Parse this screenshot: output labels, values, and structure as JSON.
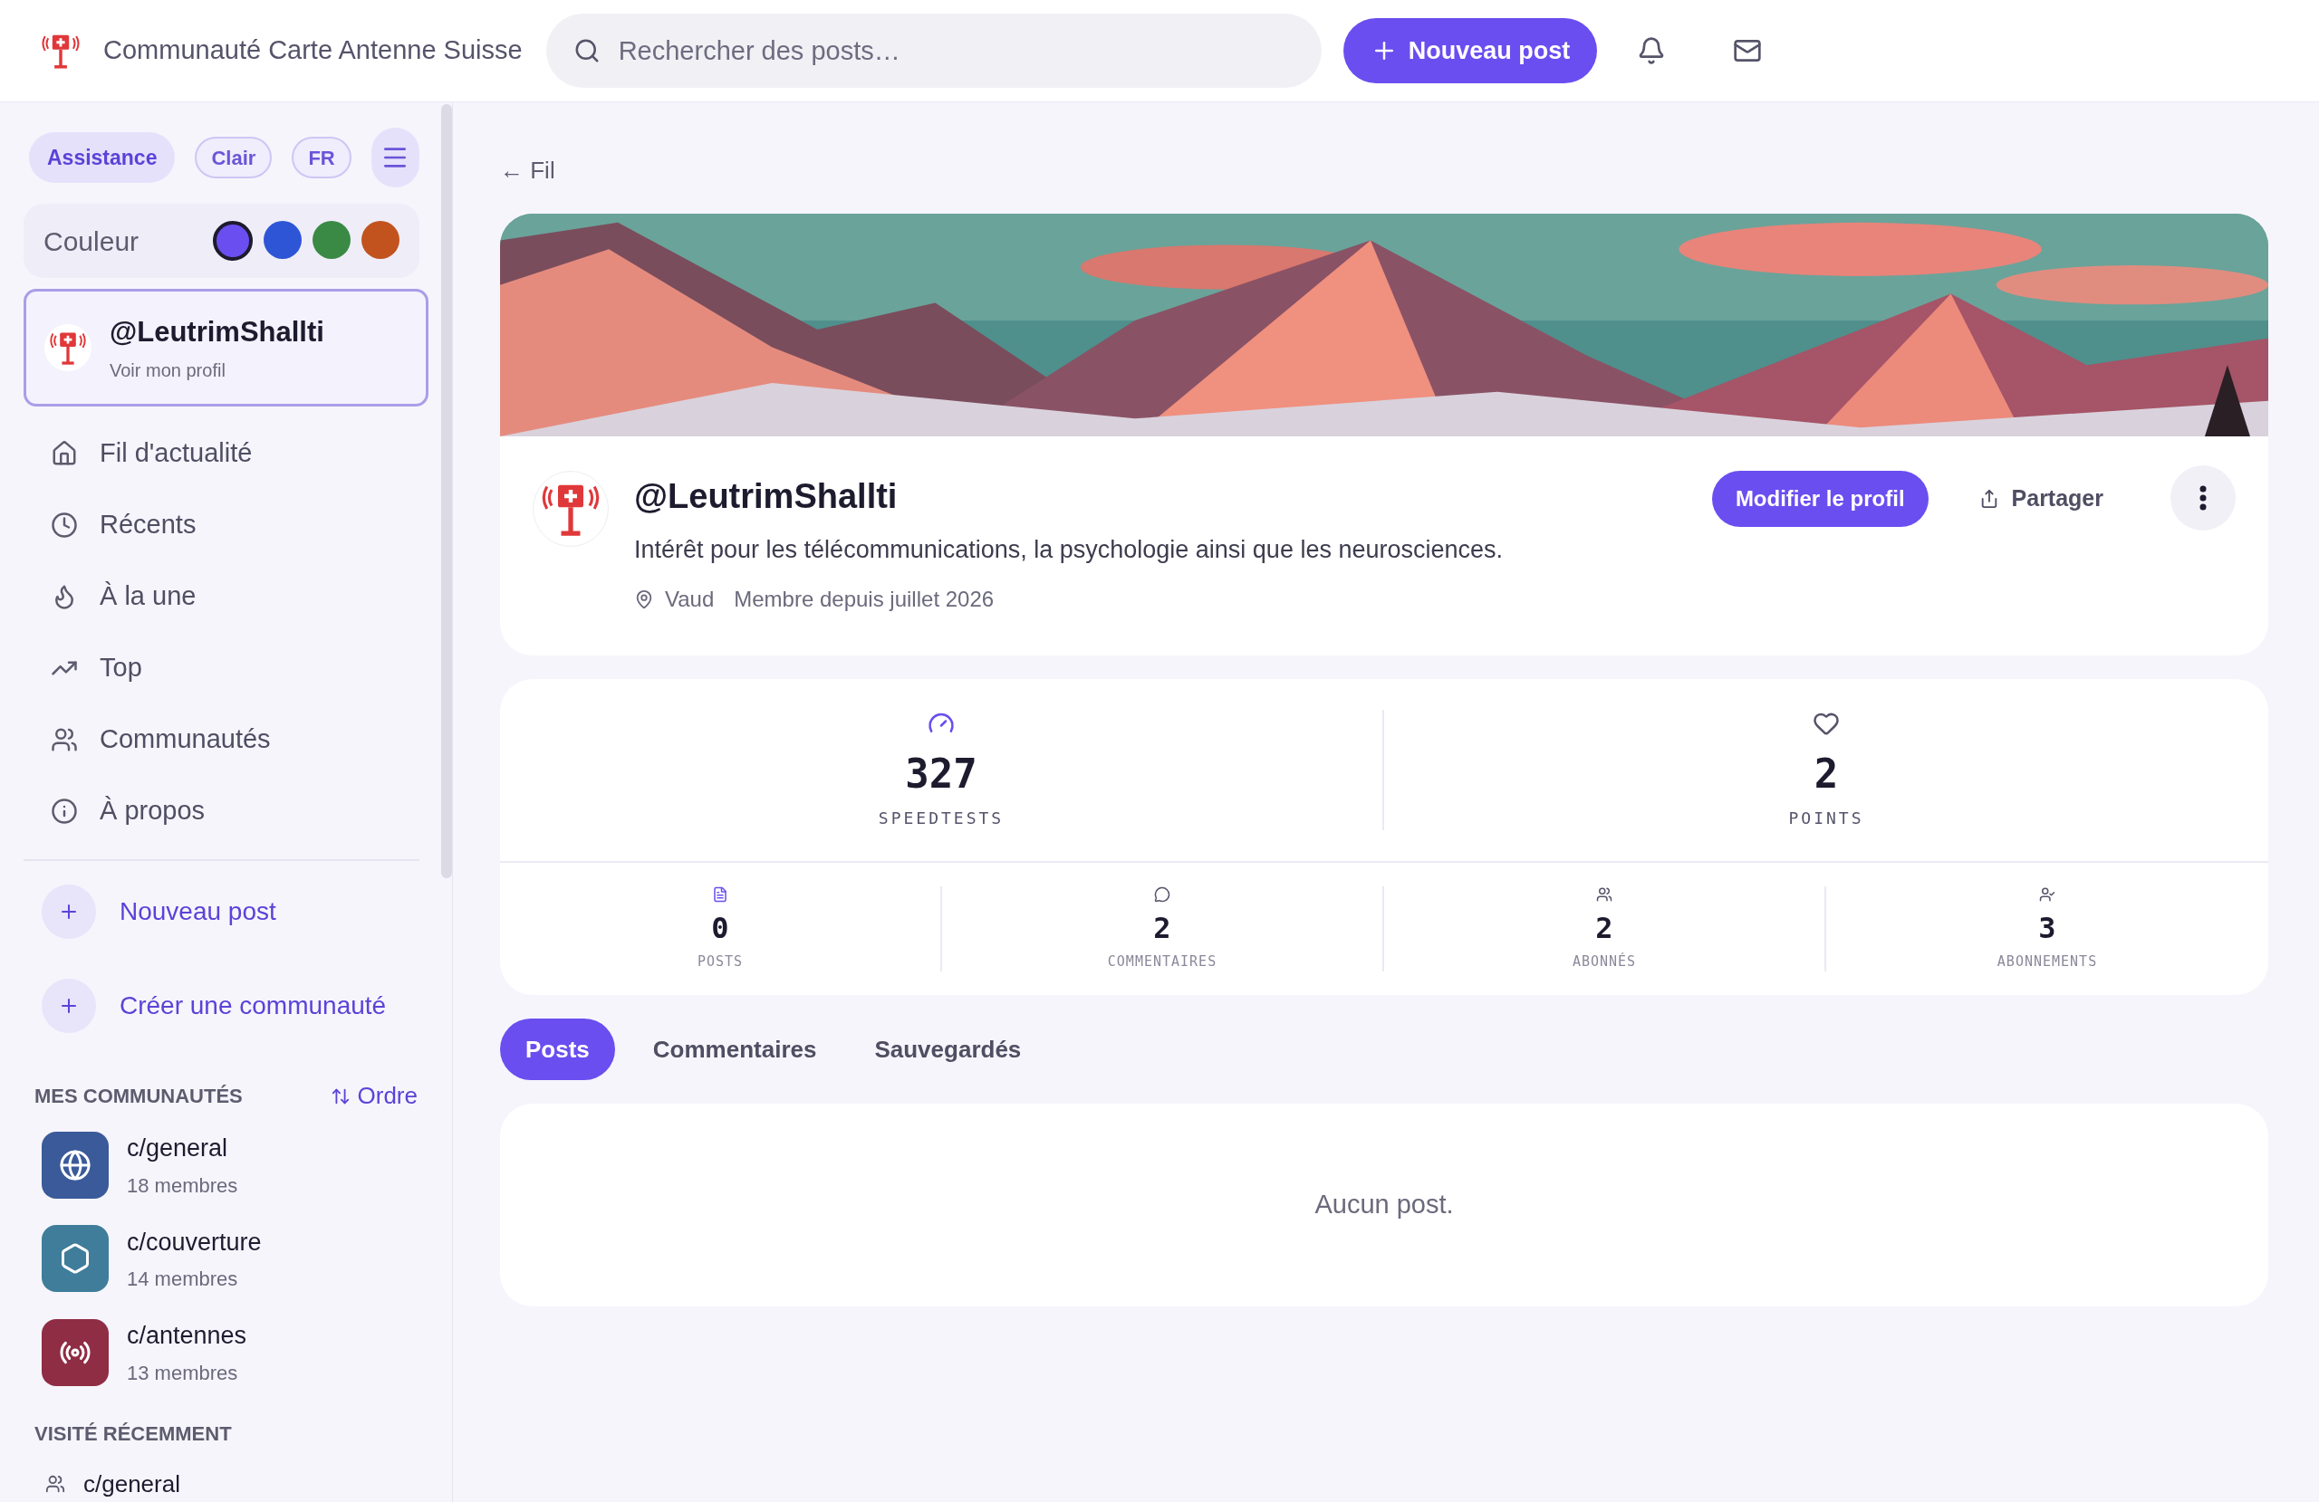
{
  "header": {
    "title": "Communauté Carte Antenne Suisse",
    "search": {
      "placeholder": "Rechercher des posts…"
    },
    "new_post": "Nouveau post"
  },
  "sidebar": {
    "chips": [
      {
        "label": "Assistance",
        "kind": "filled"
      },
      {
        "label": "Clair",
        "kind": "outline"
      },
      {
        "label": "FR",
        "kind": "outline"
      }
    ],
    "color_label": "Couleur",
    "colors": [
      {
        "color": "#6b4ef0",
        "selected": true
      },
      {
        "color": "#2d55d6",
        "selected": false
      },
      {
        "color": "#3a8a45",
        "selected": false
      },
      {
        "color": "#c2531f",
        "selected": false
      }
    ],
    "profile": {
      "name": "@LeutrimShallti",
      "link": "Voir mon profil"
    },
    "nav": [
      {
        "label": "Fil d'actualité"
      },
      {
        "label": "Récents"
      },
      {
        "label": "À la une"
      },
      {
        "label": "Top"
      },
      {
        "label": "Communautés"
      },
      {
        "label": "À propos"
      }
    ],
    "actions": [
      "Nouveau post",
      "Créer une communauté"
    ],
    "my_communities": {
      "title": "MES COMMUNAUTÉS",
      "sort": "Ordre",
      "items": [
        {
          "name": "c/general",
          "members": "18 membres",
          "color": "#3a5a9a"
        },
        {
          "name": "c/couverture",
          "members": "14 membres",
          "color": "#3f7d9a"
        },
        {
          "name": "c/antennes",
          "members": "13 membres",
          "color": "#8f2d45"
        }
      ]
    },
    "recent": {
      "title": "VISITÉ RÉCEMMENT",
      "items": [
        "c/general"
      ]
    }
  },
  "main": {
    "back": "← Fil",
    "profile": {
      "name": "@LeutrimShallti",
      "bio": "Intérêt pour les télécommunications, la psychologie ainsi que les neurosciences.",
      "location": "Vaud",
      "since": "Membre depuis juillet 2026",
      "edit": "Modifier le profil",
      "share": "Partager"
    },
    "big_stats": [
      {
        "value": "327",
        "label": "SPEEDTESTS"
      },
      {
        "value": "2",
        "label": "POINTS"
      }
    ],
    "small_stats": [
      {
        "value": "0",
        "label": "POSTS"
      },
      {
        "value": "2",
        "label": "COMMENTAIRES"
      },
      {
        "value": "2",
        "label": "ABONNÉS"
      },
      {
        "value": "3",
        "label": "ABONNEMENTS"
      }
    ],
    "tabs": [
      {
        "label": "Posts",
        "selected": true
      },
      {
        "label": "Commentaires",
        "selected": false
      },
      {
        "label": "Sauvegardés",
        "selected": false
      }
    ],
    "empty": "Aucun post."
  }
}
